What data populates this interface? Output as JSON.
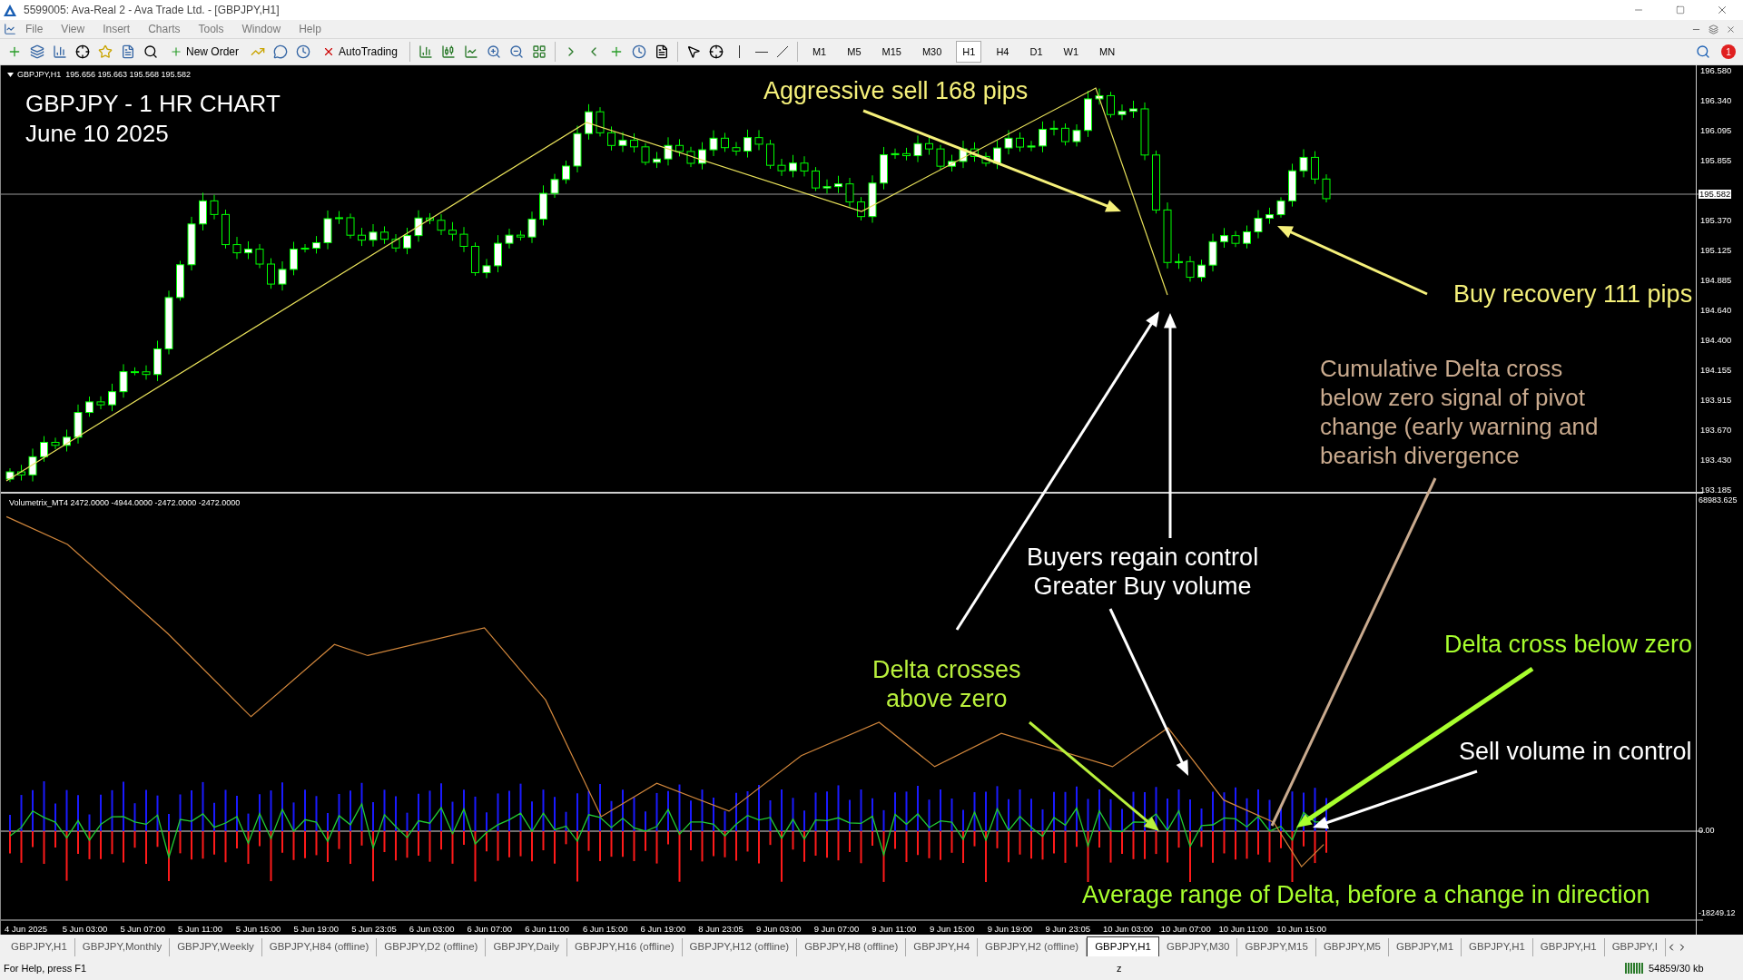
{
  "window": {
    "title": "5599005: Ava-Real 2 - Ava Trade Ltd. - [GBPJPY,H1]"
  },
  "menu": [
    "File",
    "View",
    "Insert",
    "Charts",
    "Tools",
    "Window",
    "Help"
  ],
  "toolbar": {
    "new_order": "New Order",
    "autotrading": "AutoTrading",
    "timeframes": [
      {
        "label": "M1",
        "selected": false
      },
      {
        "label": "M5",
        "selected": false
      },
      {
        "label": "M15",
        "selected": false
      },
      {
        "label": "M30",
        "selected": false
      },
      {
        "label": "H1",
        "selected": true
      },
      {
        "label": "H4",
        "selected": false
      },
      {
        "label": "D1",
        "selected": false
      },
      {
        "label": "W1",
        "selected": false
      },
      {
        "label": "MN",
        "selected": false
      }
    ],
    "alerts": "1"
  },
  "chart": {
    "header": "GBPJPY,H1  195.656 195.663 195.568 195.582",
    "title_lines": [
      "GBPJPY - 1 HR CHART",
      "June 10 2025"
    ],
    "price_axis": [
      "196.580",
      "196.340",
      "196.095",
      "195.855",
      "195.370",
      "195.125",
      "194.885",
      "194.640",
      "194.400",
      "194.155",
      "193.915",
      "193.670",
      "193.430",
      "193.185"
    ],
    "current_price": "195.582",
    "indicator_label": "Volumetrix_MT4 2472.0000 -4944.0000 -2472.0000 -2472.0000",
    "indicator_axis": [
      "68983.625",
      "0.00",
      "-18249.12"
    ],
    "time_axis": [
      "4 Jun 2025",
      "5 Jun 03:00",
      "5 Jun 07:00",
      "5 Jun 11:00",
      "5 Jun 15:00",
      "5 Jun 19:00",
      "5 Jun 23:05",
      "6 Jun 03:00",
      "6 Jun 07:00",
      "6 Jun 11:00",
      "6 Jun 15:00",
      "6 Jun 19:00",
      "8 Jun 23:05",
      "9 Jun 03:00",
      "9 Jun 07:00",
      "9 Jun 11:00",
      "9 Jun 15:00",
      "9 Jun 19:00",
      "9 Jun 23:05",
      "10 Jun 03:00",
      "10 Jun 07:00",
      "10 Jun 11:00",
      "10 Jun 15:00"
    ],
    "annotations": [
      {
        "lines": [
          "Aggressive sell 168 pips"
        ],
        "color": "#f5f07a"
      },
      {
        "lines": [
          "Buy recovery 111 pips"
        ],
        "color": "#f5f07a"
      },
      {
        "lines": [
          "Cumulative Delta cross below zero signal of pivot change (early warning and bearish divergence"
        ],
        "color": "#c9aa8e"
      },
      {
        "lines": [
          "Buyers regain control",
          "Greater Buy volume"
        ],
        "color": "#ffffff"
      },
      {
        "lines": [
          "Delta crosses",
          "above zero"
        ],
        "color": "#b9f03c"
      },
      {
        "lines": [
          "Delta cross below zero"
        ],
        "color": "#a8ff2e"
      },
      {
        "lines": [
          "Sell volume in control"
        ],
        "color": "#ffffff"
      },
      {
        "lines": [
          "Average range of Delta, before a change in direction"
        ],
        "color": "#a8ff2e"
      }
    ]
  },
  "tabs": [
    {
      "label": "GBPJPY,H1",
      "selected": false
    },
    {
      "label": "GBPJPY,Monthly",
      "selected": false
    },
    {
      "label": "GBPJPY,Weekly",
      "selected": false
    },
    {
      "label": "GBPJPY,H84 (offline)",
      "selected": false
    },
    {
      "label": "GBPJPY,D2 (offline)",
      "selected": false
    },
    {
      "label": "GBPJPY,Daily",
      "selected": false
    },
    {
      "label": "GBPJPY,H16 (offline)",
      "selected": false
    },
    {
      "label": "GBPJPY,H12 (offline)",
      "selected": false
    },
    {
      "label": "GBPJPY,H8 (offline)",
      "selected": false
    },
    {
      "label": "GBPJPY,H4",
      "selected": false
    },
    {
      "label": "GBPJPY,H2 (offline)",
      "selected": false
    },
    {
      "label": "GBPJPY,H1",
      "selected": true
    },
    {
      "label": "GBPJPY,M30",
      "selected": false
    },
    {
      "label": "GBPJPY,M15",
      "selected": false
    },
    {
      "label": "GBPJPY,M5",
      "selected": false
    },
    {
      "label": "GBPJPY,M1",
      "selected": false
    },
    {
      "label": "GBPJPY,H1",
      "selected": false
    },
    {
      "label": "GBPJPY,H1",
      "selected": false
    },
    {
      "label": "GBPJPY,I",
      "selected": false
    }
  ],
  "status_bar": {
    "help": "For Help, press F1",
    "profile": "z",
    "traffic": "54859/30 kb"
  }
}
